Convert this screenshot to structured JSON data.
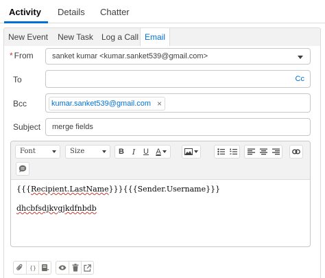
{
  "top_tabs": [
    {
      "label": "Activity",
      "active": true
    },
    {
      "label": "Details",
      "active": false
    },
    {
      "label": "Chatter",
      "active": false
    }
  ],
  "sub_tabs": [
    {
      "label": "New Event",
      "active": false
    },
    {
      "label": "New Task",
      "active": false
    },
    {
      "label": "Log a Call",
      "active": false
    },
    {
      "label": "Email",
      "active": true
    }
  ],
  "form": {
    "from_required": "*",
    "from_label": "From",
    "from_value": "sanket kumar <kumar.sanket539@gmail.com>",
    "to_label": "To",
    "to_value": "",
    "cc_label": "Cc",
    "bcc_label": "Bcc",
    "bcc_pill": "kumar.sanket539@gmail.com",
    "bcc_pill_remove": "×",
    "subject_label": "Subject",
    "subject_value": "merge fields"
  },
  "editor": {
    "font_select": "Font",
    "size_select": "Size",
    "bold": "B",
    "italic": "I",
    "underline": "U",
    "text_color": "A",
    "body_line1_prefix": "{{{",
    "body_line1_merge1": "Recipient.LastName",
    "body_line1_mid": "}}}{{{",
    "body_line1_merge2": "Sender.Username",
    "body_line1_suffix": "}}}",
    "body_line2": "dhcbfsdjkvgjkdfnbdb"
  },
  "colors": {
    "accent": "#0070d2",
    "border": "#dddbda",
    "toolbar_bg": "#f3f2f2",
    "required": "#c23934",
    "spell_error": "#c23934"
  },
  "icons": {
    "bottom": [
      "paperclip-icon",
      "merge-field-icon",
      "template-icon",
      "preview-icon",
      "delete-icon",
      "popout-icon"
    ]
  }
}
